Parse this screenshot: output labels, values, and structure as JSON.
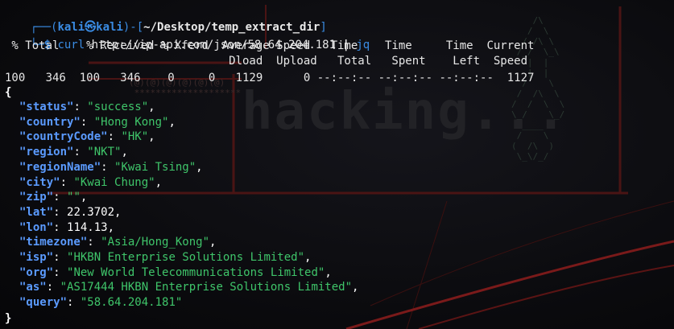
{
  "prompt": {
    "user": "kali",
    "at": "㉿",
    "host": "kali",
    "path": "~/Desktop/temp_extract_dir",
    "dollar": "$"
  },
  "command": {
    "program": "curl",
    "args": "http://ip-api.com/json/58.64.204.181",
    "pipe": "|",
    "filter": "jq"
  },
  "progress": {
    "header1": " % Total    % Received % Xferd  Average Speed   Time    Time     Time  Current",
    "header2": "                                 Dload  Upload   Total   Spent    Left  Speed",
    "row": "100   346  100   346    0     0   1129      0 --:--:-- --:--:-- --:--:--  1127"
  },
  "json": {
    "open": "{",
    "close": "}",
    "fields": [
      {
        "key": "\"status\"",
        "value": "\"success\"",
        "type": "str",
        "comma": ","
      },
      {
        "key": "\"country\"",
        "value": "\"Hong Kong\"",
        "type": "str",
        "comma": ","
      },
      {
        "key": "\"countryCode\"",
        "value": "\"HK\"",
        "type": "str",
        "comma": ","
      },
      {
        "key": "\"region\"",
        "value": "\"NKT\"",
        "type": "str",
        "comma": ","
      },
      {
        "key": "\"regionName\"",
        "value": "\"Kwai Tsing\"",
        "type": "str",
        "comma": ","
      },
      {
        "key": "\"city\"",
        "value": "\"Kwai Chung\"",
        "type": "str",
        "comma": ","
      },
      {
        "key": "\"zip\"",
        "value": "\"\"",
        "type": "str",
        "comma": ","
      },
      {
        "key": "\"lat\"",
        "value": "22.3702",
        "type": "num",
        "comma": ","
      },
      {
        "key": "\"lon\"",
        "value": "114.13",
        "type": "num",
        "comma": ","
      },
      {
        "key": "\"timezone\"",
        "value": "\"Asia/Hong_Kong\"",
        "type": "str",
        "comma": ","
      },
      {
        "key": "\"isp\"",
        "value": "\"HKBN Enterprise Solutions Limited\"",
        "type": "str",
        "comma": ","
      },
      {
        "key": "\"org\"",
        "value": "\"New World Telecommunications Limited\"",
        "type": "str",
        "comma": ","
      },
      {
        "key": "\"as\"",
        "value": "\"AS17444 HKBN Enterprise Solutions Limited\"",
        "type": "str",
        "comma": ","
      },
      {
        "key": "\"query\"",
        "value": "\"58.64.204.181\"",
        "type": "str",
        "comma": ""
      }
    ]
  },
  "wallpaper": {
    "big_text": "hacking...",
    "colors": {
      "prompt_blue": "#3a8be2",
      "json_key": "#5b9bff",
      "json_string": "#3fc56a",
      "accent_red": "#7a1a1a"
    }
  }
}
